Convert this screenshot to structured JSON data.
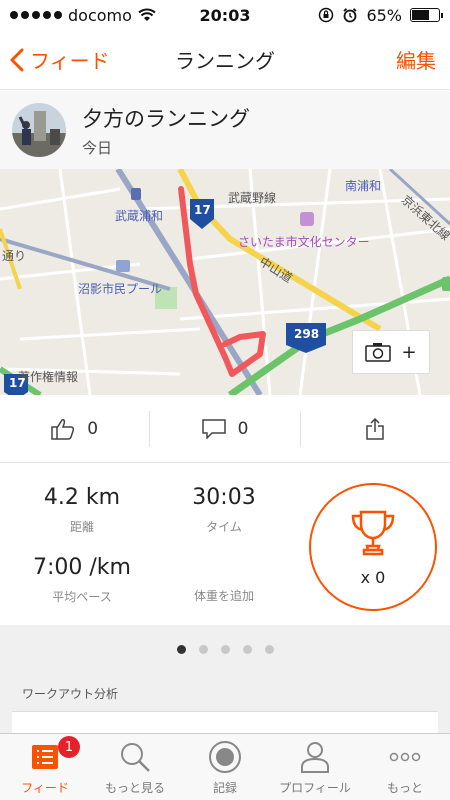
{
  "status_bar": {
    "carrier": "docomo",
    "time": "20:03",
    "battery": "65%",
    "battery_level": 0.65
  },
  "nav": {
    "back_label": "フィード",
    "title": "ランニング",
    "edit_label": "編集"
  },
  "activity": {
    "title": "夕方のランニング",
    "date": "今日"
  },
  "map": {
    "labels": {
      "musashino_line": "武蔵野線",
      "minami_urawa": "南浦和",
      "musashi_urawa": "武蔵浦和",
      "culture_center": "さいたま市文化センター",
      "nakasendo": "中山道",
      "pool": "沼影市民プール",
      "keihin": "京浜東北線",
      "dori": "通り",
      "copyright": "著作権情報",
      "route_17_top": "17",
      "route_17_left": "17",
      "route_298": "298"
    },
    "camera_plus": "+"
  },
  "actions": {
    "kudos_count": "0",
    "comments_count": "0"
  },
  "stats": {
    "distance_value": "4.2 km",
    "distance_label": "距離",
    "time_value": "30:03",
    "time_label": "タイム",
    "pace_value": "7:00 /km",
    "pace_label": "平均ペース",
    "weight_label": "体重を追加",
    "trophy_count": "x 0"
  },
  "analysis": {
    "title": "ワークアウト分析",
    "page_index": 1,
    "page_count": 5
  },
  "tabs": {
    "feed": "フィード",
    "explore": "もっと見る",
    "record": "記録",
    "profile": "プロフィール",
    "more": "もっと",
    "feed_badge": "1"
  },
  "colors": {
    "accent": "#fc5200",
    "route": "#f0585b",
    "badge": "#e8202a"
  }
}
